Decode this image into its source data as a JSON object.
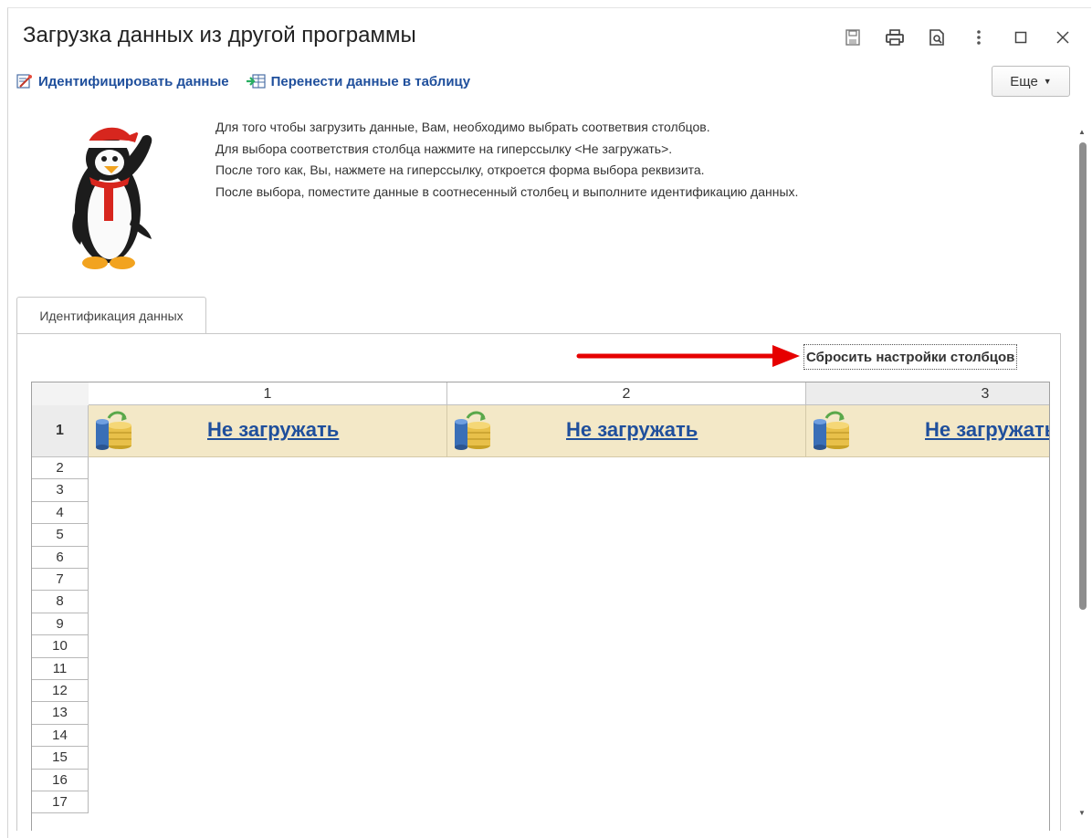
{
  "window": {
    "title": "Загрузка данных из другой программы"
  },
  "toolbar": {
    "identify_label": "Идентифицировать данные",
    "transfer_label": "Перенести данные в таблицу",
    "more_label": "Еще"
  },
  "info_lines": [
    "Для того чтобы загрузить данные, Вам, необходимо выбрать соответвия столбцов.",
    "Для выбора соответствия столбца нажмите на гиперссылку <Не загружать>.",
    "После того как, Вы, нажмете на гиперссылку, откроется форма выбора реквизита.",
    "После выбора, поместите данные в соотнесенный столбец и выполните идентификацию данных."
  ],
  "tab": {
    "label": "Идентификация данных"
  },
  "reset_label": "Сбросить настройки столбцов",
  "grid": {
    "columns": [
      "1",
      "2",
      "3"
    ],
    "first_row_label": "1",
    "cell_link": "Не загружать",
    "row_numbers": [
      "2",
      "3",
      "4",
      "5",
      "6",
      "7",
      "8",
      "9",
      "10",
      "11",
      "12",
      "13",
      "14",
      "15",
      "16",
      "17"
    ]
  },
  "colors": {
    "link": "#1f4f9c",
    "header_cell": "#f3e8c7",
    "arrow": "#e60000"
  },
  "icons": [
    "save-icon",
    "print-icon",
    "preview-icon",
    "more-vert-icon",
    "maximize-icon",
    "close-icon",
    "identify-icon",
    "transfer-icon",
    "database-icon",
    "penguin-mascot"
  ]
}
